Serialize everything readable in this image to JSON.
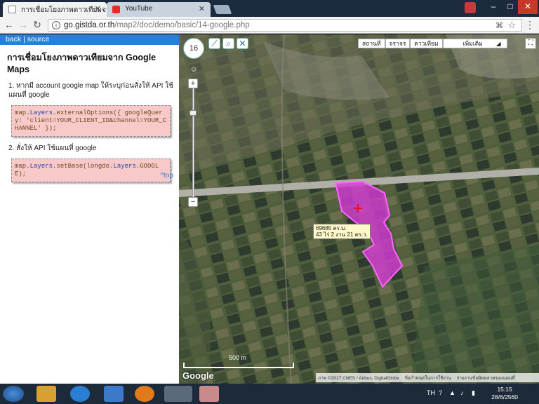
{
  "browser": {
    "tabs": [
      {
        "title": "การเชื่อมโยงภาพดาวเทียมจา",
        "active": true,
        "icon": "page-icon"
      },
      {
        "title": "YouTube",
        "active": false,
        "icon": "youtube-icon"
      }
    ],
    "url_host": "go.gistda.or.th",
    "url_path": "/map2/doc/demo/basic/14-google.php",
    "user_badge": "",
    "window_controls": [
      "–",
      "□",
      "✕"
    ]
  },
  "panel": {
    "back": "back",
    "separator": "|",
    "source": "source",
    "title": "การเชื่อมโยงภาพดาวเทียมจาก Google Maps",
    "step1": "1. หากมี account google map ให้ระบุก่อนสั่งให้ API ใช้ แผนที่ google",
    "code1_a": "map.",
    "code1_b": "Layers",
    "code1_c": ".externalOptions({ googleQuery: 'client=YOUR_CLIENT_ID&channel=YOUR_CHANNEL' });",
    "step2": "2. สั่งให้ API ใช้แผนที่ google",
    "code2_a": "map.",
    "code2_b": "Layers",
    "code2_c": ".setBase(longdo.",
    "code2_d": "Layers",
    "code2_e": ".GOOGLE);",
    "top_link": "^top"
  },
  "map": {
    "zoom_level": "16",
    "tabs": [
      "สถานที่",
      "จราจร",
      "ดาวเทียม"
    ],
    "layer_select": "เพิ่มเติม",
    "area_line1": "69685 ตร.ม.",
    "area_line2": "43 ไร่ 2 งาน 21 ตร.ว.",
    "scale": "500 m",
    "logo": "Google",
    "attribution": [
      "ภาพ ©2017 CNES / Airbus, DigitalGlobe",
      "ข้อกำหนดในการใช้งาน",
      "รายงานข้อผิดพลาดของแผนที่"
    ],
    "polygon_color": "#d63ad6"
  },
  "taskbar": {
    "lang": "TH",
    "time": "15:15",
    "date": "28/6/2560"
  }
}
